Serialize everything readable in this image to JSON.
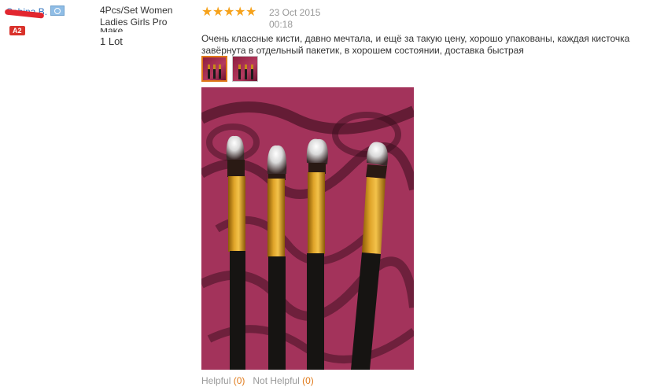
{
  "reviewer": {
    "name": "Sabina B.",
    "level_badge": "A2",
    "country_flag_icon": "flag-icon"
  },
  "product": {
    "title": "4Pcs/Set Women Ladies Girls Pro",
    "title_cut": "Make",
    "quantity": "1 Lot"
  },
  "review": {
    "rating": 5,
    "rating_max": 5,
    "date": "23 Oct 2015",
    "time": "00:18",
    "text": "Очень классные кисти, давно мечтала, и ещё за такую цену, хорошо упакованы, каждая кисточка завёрнута в отдельный пакетик, в хорошем состоянии, доставка быстрая",
    "photo_count": 2,
    "selected_photo": 1
  },
  "votes": {
    "helpful_label": "Helpful",
    "helpful_count": "(0)",
    "not_helpful_label": "Not Helpful",
    "not_helpful_count": "(0)"
  },
  "colors": {
    "star": "#f6a21b",
    "link": "#2a6ebb",
    "badge": "#d9322b",
    "accent": "#e07a1a"
  }
}
